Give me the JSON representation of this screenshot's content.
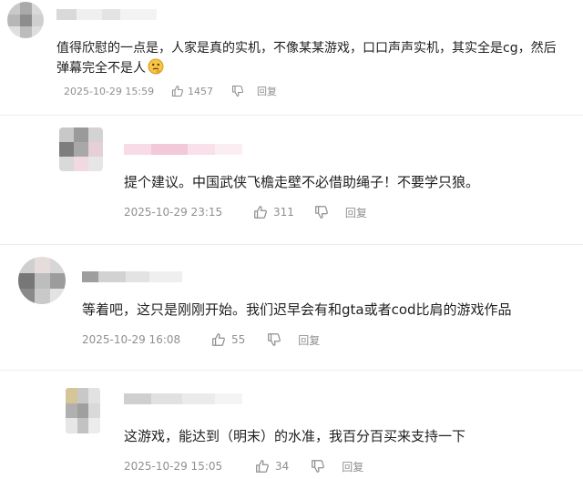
{
  "comments": [
    {
      "text_line1": "值得欣慰的一点是，人家是真的实机，不像某某游戏，口口声声实机，其实全是cg，然后",
      "text_line2": "弹幕完全不是人",
      "emoji_icon": "thinking-face-emoji",
      "timestamp": "2025-10-29 15:59",
      "likes": "1457",
      "reply_label": "回复"
    },
    {
      "text": "提个建议。中国武侠飞檐走壁不必借助绳子！不要学只狼。",
      "timestamp": "2025-10-29 23:15",
      "likes": "311",
      "reply_label": "回复"
    },
    {
      "text": "等着吧，这只是刚刚开始。我们迟早会有和gta或者cod比肩的游戏作品",
      "timestamp": "2025-10-29 16:08",
      "likes": "55",
      "reply_label": "回复"
    },
    {
      "text": "这游戏，能达到（明末）的水准，我百分百买来支持一下",
      "timestamp": "2025-10-29 15:05",
      "likes": "34",
      "reply_label": "回复"
    }
  ],
  "colors": {
    "meta_text": "#8f8f8f",
    "body_text": "#1f1f1f",
    "username_blur": "#f2c9d9"
  }
}
